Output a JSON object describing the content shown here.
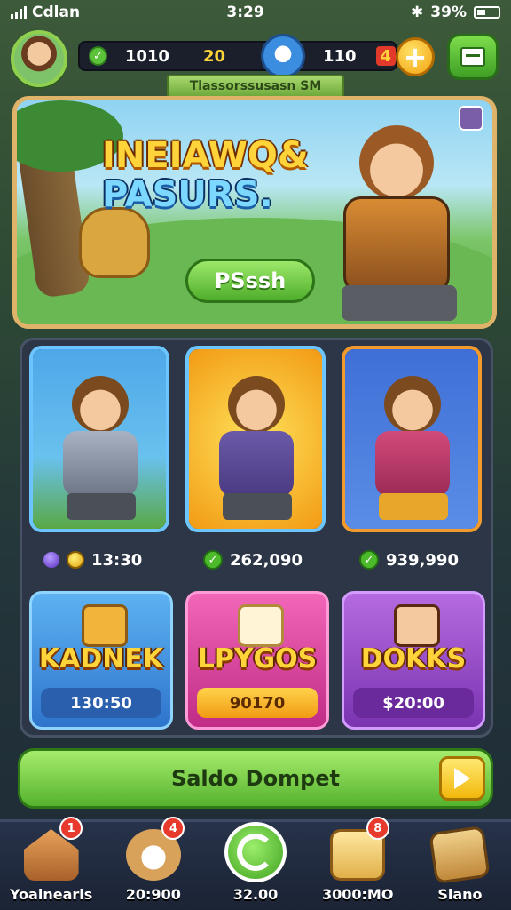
{
  "status_bar": {
    "carrier": "Cdlan",
    "time": "3:29",
    "battery": "39%"
  },
  "top_bar": {
    "currency_1": "1010",
    "currency_2": "20",
    "currency_3": "110",
    "currency_4": "4"
  },
  "banner": {
    "subtitle": "Tlassorssusasn SM",
    "title_line1": "INEIAWQ&",
    "title_line2": "PASURS.",
    "play_label": "PSssh"
  },
  "heroes": [
    {
      "price": "13:30",
      "currency": "coin",
      "accent": "#69b8f0"
    },
    {
      "price": "262,090",
      "currency": "check",
      "accent": "#69b8f0"
    },
    {
      "price": "939,990",
      "currency": "check",
      "accent": "#f29b2c"
    }
  ],
  "offers": [
    {
      "name": "KADNEK",
      "price": "130:50",
      "bg": "#3d8fe0"
    },
    {
      "name": "LPYGOS",
      "price": "90170",
      "bg": "#e04aa8"
    },
    {
      "name": "DOKKS",
      "price": "$20:00",
      "bg": "#9b49c9"
    }
  ],
  "cta": {
    "label": "Saldo Dompet"
  },
  "nav": [
    {
      "label": "Yoalnearls",
      "badge": "1",
      "icon": "house-icon"
    },
    {
      "label": "20:900",
      "badge": "4",
      "icon": "pet-icon"
    },
    {
      "label": "32.00",
      "badge": "",
      "icon": "refresh-icon"
    },
    {
      "label": "3000:MO",
      "badge": "8",
      "icon": "chest-icon"
    },
    {
      "label": "Slano",
      "badge": "",
      "icon": "card-icon"
    }
  ]
}
